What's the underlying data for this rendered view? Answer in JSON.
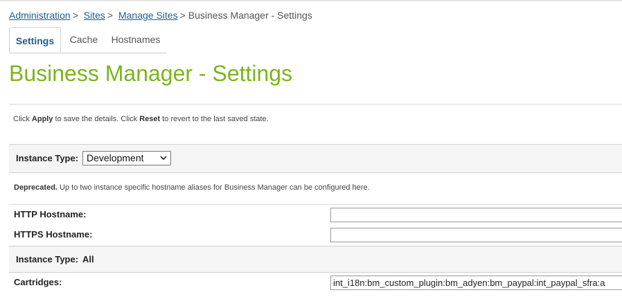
{
  "breadcrumb": {
    "items": [
      "Administration",
      "Sites",
      "Manage Sites"
    ],
    "separator": ">",
    "current": "Business Manager - Settings"
  },
  "tabs": [
    {
      "label": "Settings",
      "active": true
    },
    {
      "label": "Cache",
      "active": false
    },
    {
      "label": "Hostnames",
      "active": false
    }
  ],
  "page_title": "Business Manager - Settings",
  "help": {
    "prefix": "Click",
    "apply": "Apply",
    "middle": "to save the details. Click",
    "reset": "Reset",
    "suffix": "to revert to the last saved state."
  },
  "instance_section": {
    "label": "Instance Type:",
    "selected": "Development"
  },
  "deprecated_note": {
    "bold": "Deprecated.",
    "text": "Up to two instance specific hostname aliases for Business Manager can be configured here."
  },
  "fields": {
    "http_label": "HTTP Hostname:",
    "http_value": "",
    "https_label": "HTTPS Hostname:",
    "https_value": ""
  },
  "all_section": {
    "label": "Instance Type:",
    "value": "All"
  },
  "cartridges": {
    "label": "Cartridges:",
    "value": "int_i18n:bm_custom_plugin:bm_adyen:bm_paypal:int_paypal_sfra:a"
  },
  "colors": {
    "title": "#7ab51d",
    "link": "#1f5d8f"
  }
}
